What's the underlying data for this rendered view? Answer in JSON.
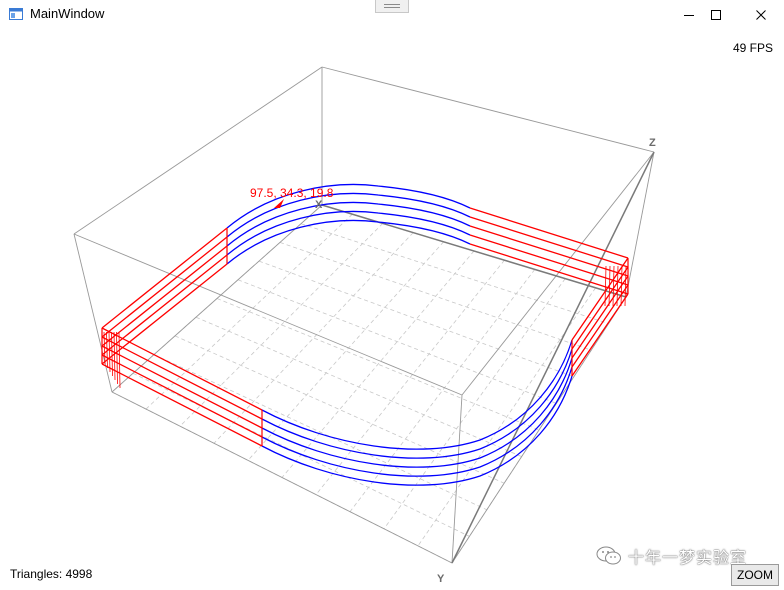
{
  "window": {
    "title": "MainWindow",
    "icons": {
      "app": "window-icon",
      "minimize": "minimize-icon",
      "maximize": "maximize-icon",
      "close": "close-icon"
    }
  },
  "overlay": {
    "fps": "49 FPS",
    "triangles": "Triangles: 4998",
    "zoom_label": "ZOOM",
    "watermark": "十年一梦实验室",
    "watermark_icon": "wechat-icon"
  },
  "plot": {
    "axis_labels": {
      "x": "X",
      "y": "Y",
      "z": "Z"
    },
    "cursor_readout": "97.5, 34.3, 19.8",
    "colors": {
      "straight_segments": "#ff0000",
      "curved_segments": "#0000ff",
      "box": "#999999",
      "grid": "#c8c8c8",
      "readout": "#ff0000",
      "axis_label": "#6b6b6b"
    }
  }
}
